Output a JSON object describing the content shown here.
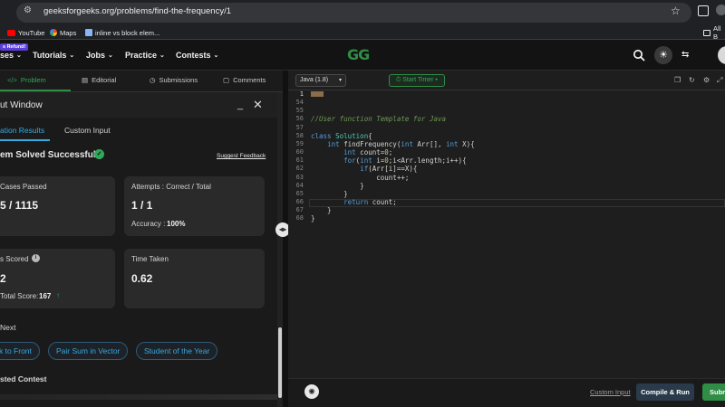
{
  "browser": {
    "url": "geeksforgeeks.org/problems/find-the-frequency/1",
    "bookmarks": [
      "YouTube",
      "Maps",
      "inline vs block elem...",
      "All B"
    ]
  },
  "header": {
    "refund_badge": "s Refund!",
    "nav": [
      "ses",
      "Tutorials",
      "Jobs",
      "Practice",
      "Contests"
    ],
    "logo": "GG"
  },
  "left_tabs": [
    "Problem",
    "Editorial",
    "Submissions",
    "Comments"
  ],
  "output_window": {
    "title": "ut Window",
    "subtabs": [
      "ation Results",
      "Custom Input"
    ],
    "solved": "em Solved Successfully",
    "feedback": "Suggest Feedback",
    "cards": {
      "cases_label": "Cases Passed",
      "cases_value": "5 / 1115",
      "attempts_label": "Attempts : Correct / Total",
      "attempts_value": "1 / 1",
      "accuracy_label": "Accuracy :",
      "accuracy_value": "100%",
      "score_label": "s Scored",
      "score_value": "2",
      "total_label": "Total Score:",
      "total_value": "167",
      "time_label": "Time Taken",
      "time_value": "0.62"
    },
    "next_label": "Next",
    "suggestions": [
      "k to Front",
      "Pair Sum in Vector",
      "Student of the Year"
    ],
    "contest_label": "sted Contest"
  },
  "editor": {
    "language": "Java (1.8)",
    "timer": "Start Timer",
    "lines": [
      {
        "n": "1",
        "code": ""
      },
      {
        "n": "54",
        "code": ""
      },
      {
        "n": "55",
        "code": ""
      },
      {
        "n": "56",
        "code": "//User function Template for Java"
      },
      {
        "n": "57",
        "code": ""
      },
      {
        "n": "58",
        "code": "class Solution{"
      },
      {
        "n": "59",
        "code": "    int findFrequency(int Arr[], int X){"
      },
      {
        "n": "60",
        "code": "        int count=0;"
      },
      {
        "n": "61",
        "code": "        for(int i=0;i<Arr.length;i++){"
      },
      {
        "n": "62",
        "code": "            if(Arr[i]==X){"
      },
      {
        "n": "63",
        "code": "                count++;"
      },
      {
        "n": "64",
        "code": "            }"
      },
      {
        "n": "65",
        "code": "        }"
      },
      {
        "n": "66",
        "code": "        return count;"
      },
      {
        "n": "67",
        "code": "    }"
      },
      {
        "n": "68",
        "code": "}"
      }
    ]
  },
  "bottom": {
    "custom_input": "Custom Input",
    "compile": "Compile & Run",
    "submit": "Subm"
  }
}
